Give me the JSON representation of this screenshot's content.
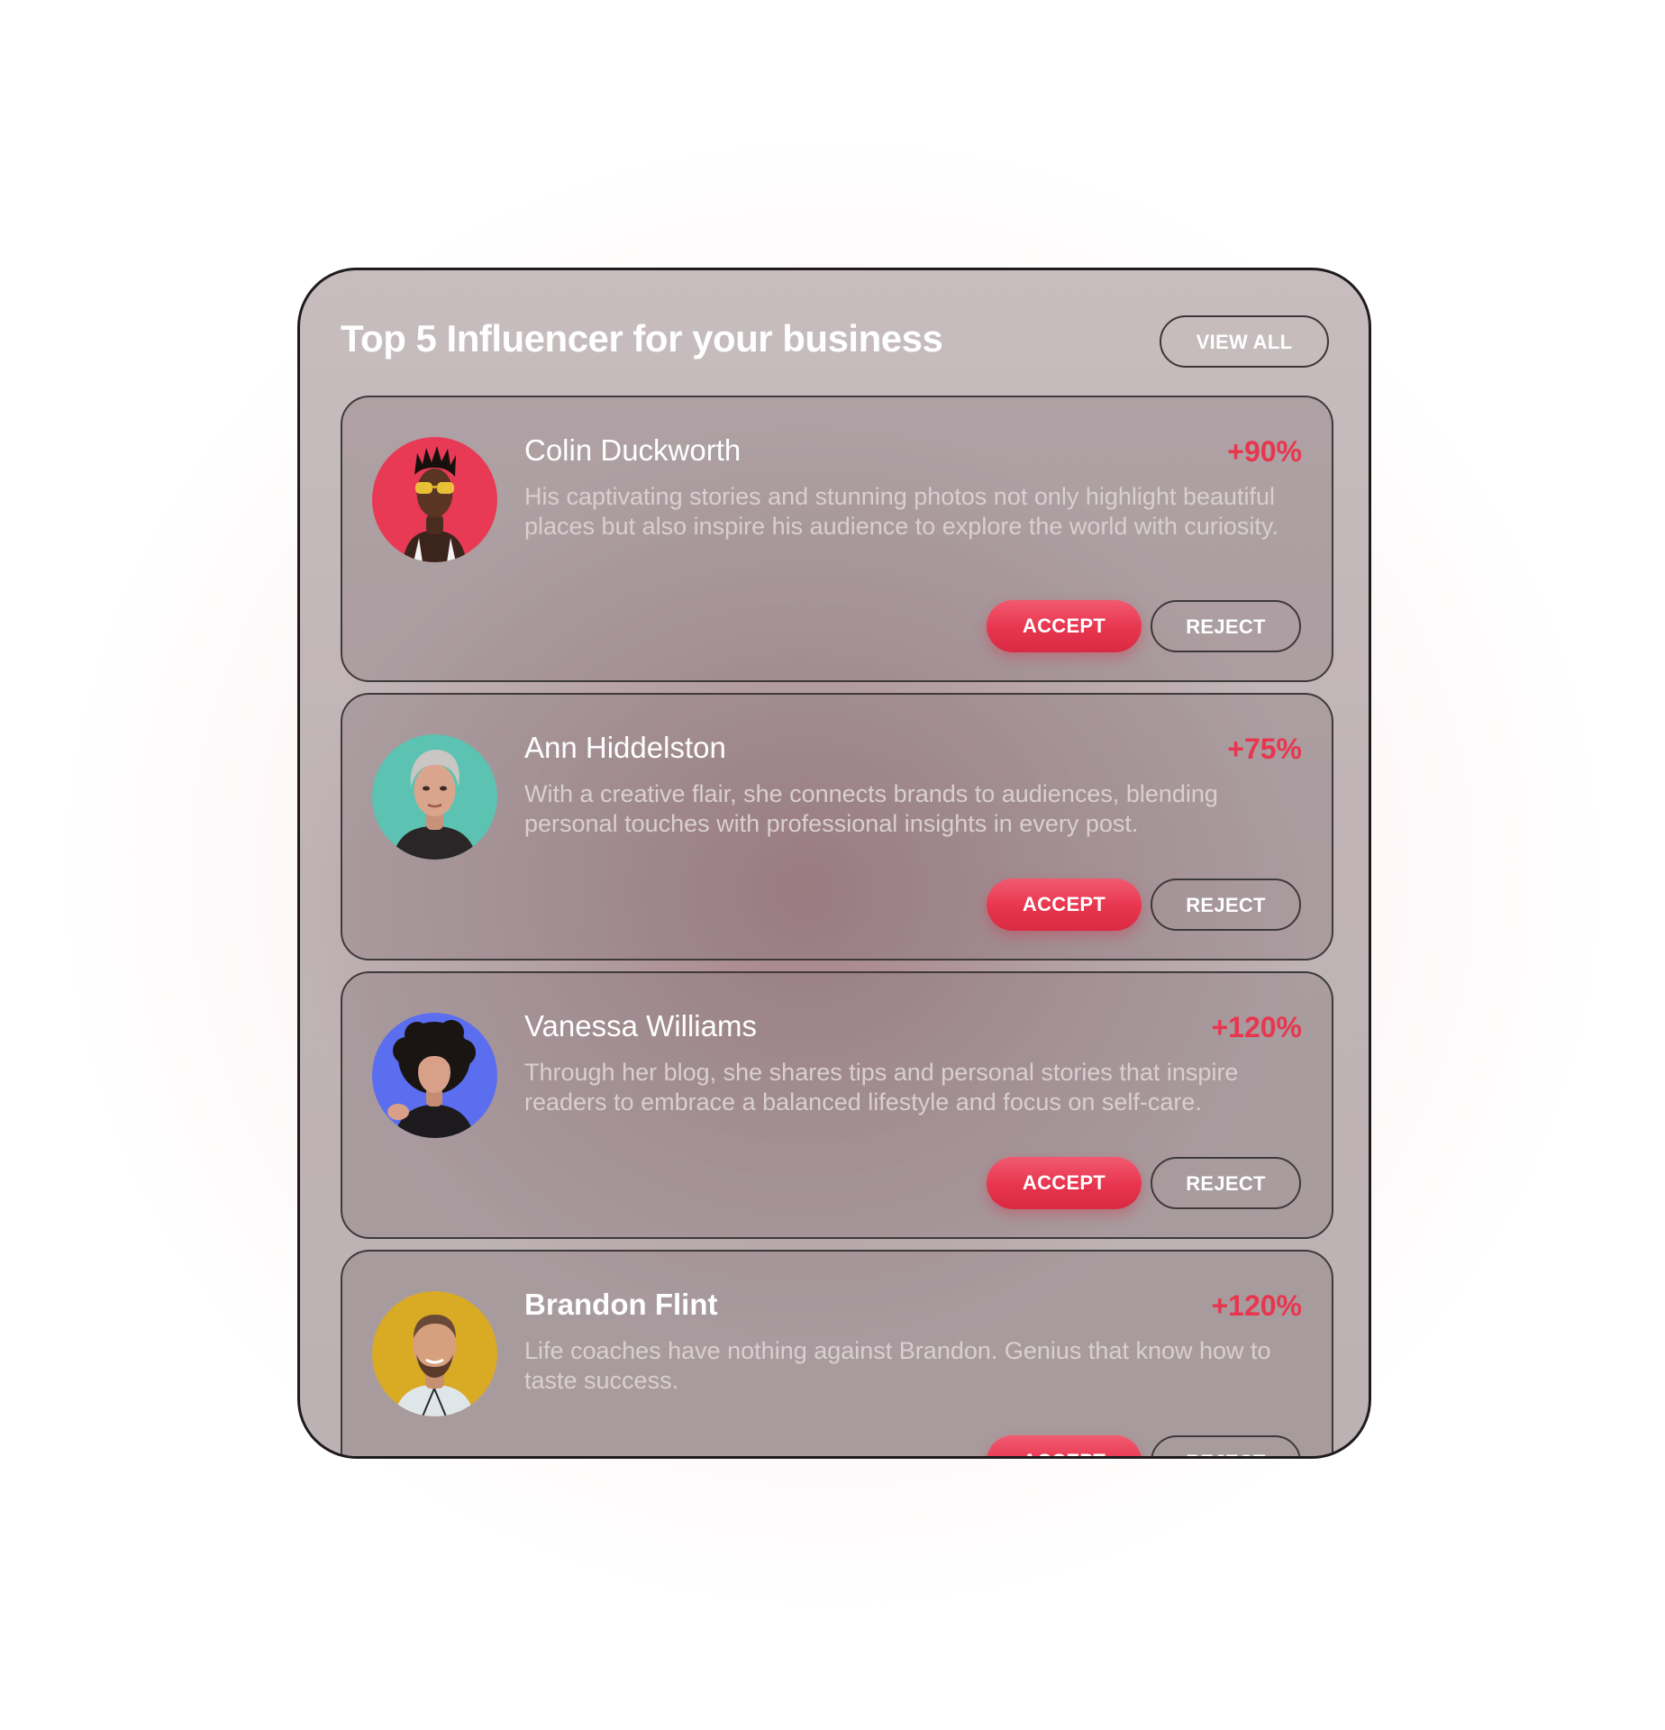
{
  "panel": {
    "title": "Top 5 Influencer for your business",
    "view_all_label": "VIEW ALL"
  },
  "influencers": [
    {
      "name": "Colin Duckworth",
      "growth": "+90%",
      "description": "His captivating stories and stunning photos not only highlight beautiful places but also inspire his audience to explore the world with curiosity.",
      "accept_label": "ACCEPT",
      "reject_label": "REJECT",
      "avatar_bg": "#e83a55"
    },
    {
      "name": "Ann Hiddelston",
      "growth": "+75%",
      "description": "With a creative flair, she connects brands to audiences, blending personal touches with professional insights in every post.",
      "accept_label": "ACCEPT",
      "reject_label": "REJECT",
      "avatar_bg": "#5cc2b1"
    },
    {
      "name": "Vanessa Williams",
      "growth": "+120%",
      "description": "Through her blog, she shares tips and personal stories that inspire readers to embrace a balanced lifestyle and focus on self-care.",
      "accept_label": "ACCEPT",
      "reject_label": "REJECT",
      "avatar_bg": "#5b6ef0"
    },
    {
      "name": "Brandon Flint",
      "growth": "+120%",
      "description": "Life coaches have nothing against Brandon. Genius that know how to taste success.",
      "accept_label": "ACCEPT",
      "reject_label": "REJECT",
      "avatar_bg": "#d9ab25"
    }
  ],
  "colors": {
    "accent": "#e8364f",
    "panel_border": "#1f1b1d",
    "text_primary": "#ffffff",
    "text_secondary": "#d9cfd1"
  }
}
